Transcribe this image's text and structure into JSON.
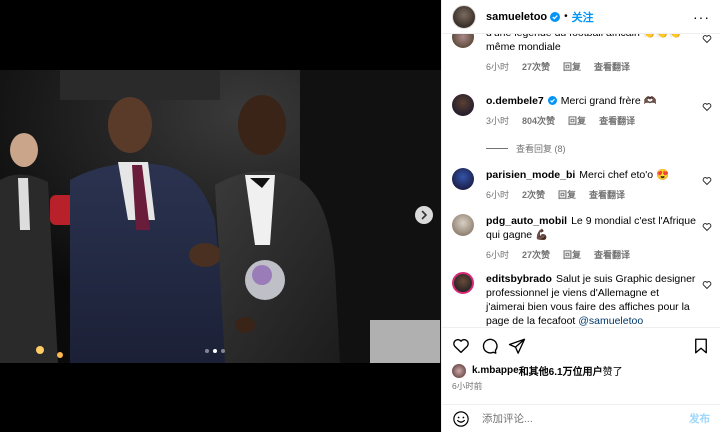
{
  "header": {
    "username": "samueletoo",
    "separator": "•",
    "follow_label": "关注",
    "more_label": "···"
  },
  "comments": [
    {
      "user": "",
      "text": "d'une légende du football africain 👏👏👏 même mondiale",
      "time": "6小时",
      "likes": "27次赞",
      "reply": "回复",
      "translate": "查看翻译"
    },
    {
      "user": "o.dembele7",
      "verified": true,
      "text": "Merci grand frère 🫶🏿",
      "time": "3小时",
      "likes": "804次赞",
      "reply": "回复",
      "translate": "查看翻译",
      "view_replies": "查看回复 (8)"
    },
    {
      "user": "parisien_mode_bi",
      "text": "Merci chef eto'o 😍",
      "time": "6小时",
      "likes": "2次赞",
      "reply": "回复",
      "translate": "查看翻译"
    },
    {
      "user": "pdg_auto_mobil",
      "text": "Le 9 mondial c'est l'Afrique qui gagne 💪🏿",
      "time": "6小时",
      "likes": "27次赞",
      "reply": "回复",
      "translate": "查看翻译"
    },
    {
      "user": "editsbybrado",
      "text": "Salut je suis Graphic designer professionnel je viens d'Allemagne et j'aimerai bien vous faire des affiches pour la page de la fecafoot",
      "mention": "@samueletoo"
    }
  ],
  "likes": {
    "first_user": "k.mbappe",
    "rest": "和其他6.1万位用户",
    "suffix": "赞了"
  },
  "post_time": "6小时前",
  "composer": {
    "placeholder": "添加评论...",
    "post_label": "发布"
  },
  "colors": {
    "accent": "#0095f6",
    "muted": "#737373",
    "post_disabled": "#9fd7fd"
  },
  "icons": [
    "verified-badge-icon",
    "more-options-icon",
    "heart-icon",
    "comment-icon",
    "share-icon",
    "bookmark-icon",
    "emoji-icon",
    "chevron-right-icon"
  ]
}
